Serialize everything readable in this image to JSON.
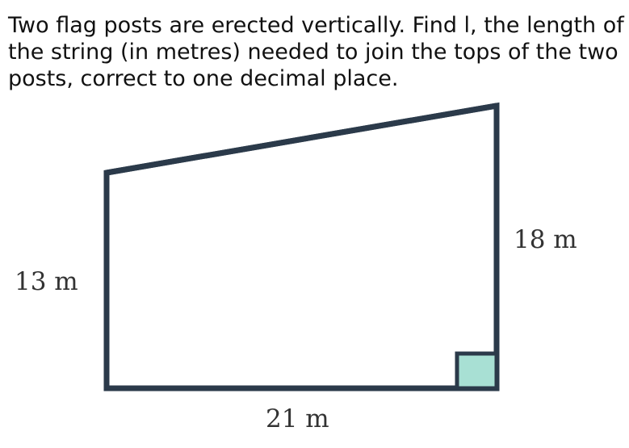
{
  "question": {
    "text": "Two flag posts are erected vertically. Find l, the length of the string (in metres) needed to join the tops of the two posts, correct to one decimal place."
  },
  "diagram": {
    "left_post_label": "13 m",
    "right_post_label": "18 m",
    "base_label": "21 m",
    "stroke_color": "#2b3a4a",
    "right_angle_fill": "#a8e0d4"
  }
}
